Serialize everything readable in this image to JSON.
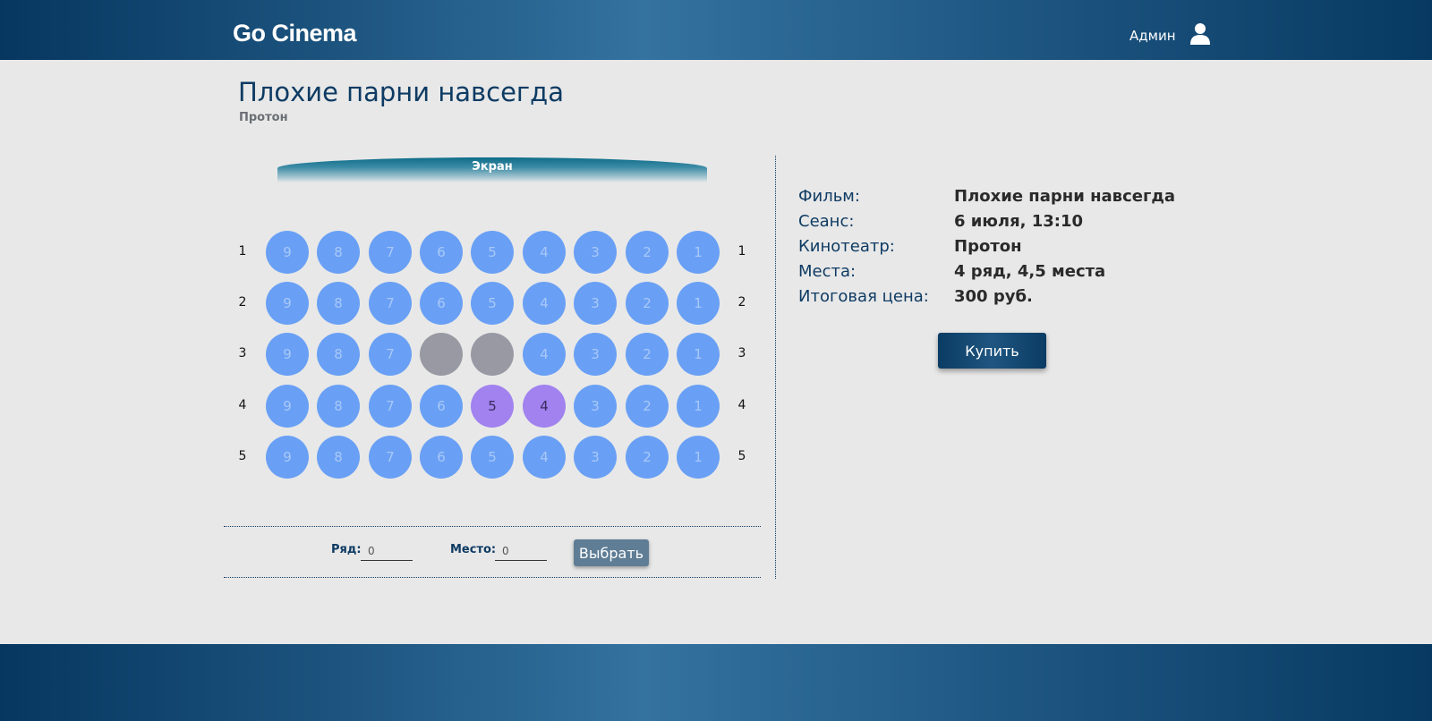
{
  "header": {
    "brand": "Go Cinema",
    "user_label": "Админ",
    "user_icon": "user-icon"
  },
  "movie": {
    "title": "Плохие парни навсегда",
    "cinema": "Протон"
  },
  "hall": {
    "screen_label": "Экран",
    "rows": [
      {
        "row": "1",
        "seats": [
          {
            "n": "9",
            "status": "free"
          },
          {
            "n": "8",
            "status": "free"
          },
          {
            "n": "7",
            "status": "free"
          },
          {
            "n": "6",
            "status": "free"
          },
          {
            "n": "5",
            "status": "free"
          },
          {
            "n": "4",
            "status": "free"
          },
          {
            "n": "3",
            "status": "free"
          },
          {
            "n": "2",
            "status": "free"
          },
          {
            "n": "1",
            "status": "free"
          }
        ]
      },
      {
        "row": "2",
        "seats": [
          {
            "n": "9",
            "status": "free"
          },
          {
            "n": "8",
            "status": "free"
          },
          {
            "n": "7",
            "status": "free"
          },
          {
            "n": "6",
            "status": "free"
          },
          {
            "n": "5",
            "status": "free"
          },
          {
            "n": "4",
            "status": "free"
          },
          {
            "n": "3",
            "status": "free"
          },
          {
            "n": "2",
            "status": "free"
          },
          {
            "n": "1",
            "status": "free"
          }
        ]
      },
      {
        "row": "3",
        "seats": [
          {
            "n": "9",
            "status": "free"
          },
          {
            "n": "8",
            "status": "free"
          },
          {
            "n": "7",
            "status": "free"
          },
          {
            "n": "6",
            "status": "taken"
          },
          {
            "n": "5",
            "status": "taken"
          },
          {
            "n": "4",
            "status": "free"
          },
          {
            "n": "3",
            "status": "free"
          },
          {
            "n": "2",
            "status": "free"
          },
          {
            "n": "1",
            "status": "free"
          }
        ]
      },
      {
        "row": "4",
        "seats": [
          {
            "n": "9",
            "status": "free"
          },
          {
            "n": "8",
            "status": "free"
          },
          {
            "n": "7",
            "status": "free"
          },
          {
            "n": "6",
            "status": "free"
          },
          {
            "n": "5",
            "status": "selected"
          },
          {
            "n": "4",
            "status": "selected"
          },
          {
            "n": "3",
            "status": "free"
          },
          {
            "n": "2",
            "status": "free"
          },
          {
            "n": "1",
            "status": "free"
          }
        ]
      },
      {
        "row": "5",
        "seats": [
          {
            "n": "9",
            "status": "free"
          },
          {
            "n": "8",
            "status": "free"
          },
          {
            "n": "7",
            "status": "free"
          },
          {
            "n": "6",
            "status": "free"
          },
          {
            "n": "5",
            "status": "free"
          },
          {
            "n": "4",
            "status": "free"
          },
          {
            "n": "3",
            "status": "free"
          },
          {
            "n": "2",
            "status": "free"
          },
          {
            "n": "1",
            "status": "free"
          }
        ]
      }
    ],
    "colors": {
      "free": "#69a0f5",
      "taken": "#9899a3",
      "selected": "#a182ef"
    }
  },
  "picker": {
    "row_label": "Ряд:",
    "row_value": "0",
    "seat_label": "Место:",
    "seat_value": "0",
    "button_label": "Выбрать"
  },
  "summary": {
    "items": [
      {
        "key": "Фильм:",
        "value": "Плохие парни навсегда"
      },
      {
        "key": "Сеанс:",
        "value": "6 июля, 13:10"
      },
      {
        "key": "Кинотеатр:",
        "value": "Протон"
      },
      {
        "key": "Места:",
        "value": "4 ряд, 4,5 места"
      },
      {
        "key": "Итоговая цена:",
        "value": "300 руб."
      }
    ],
    "buy_label": "Купить"
  }
}
